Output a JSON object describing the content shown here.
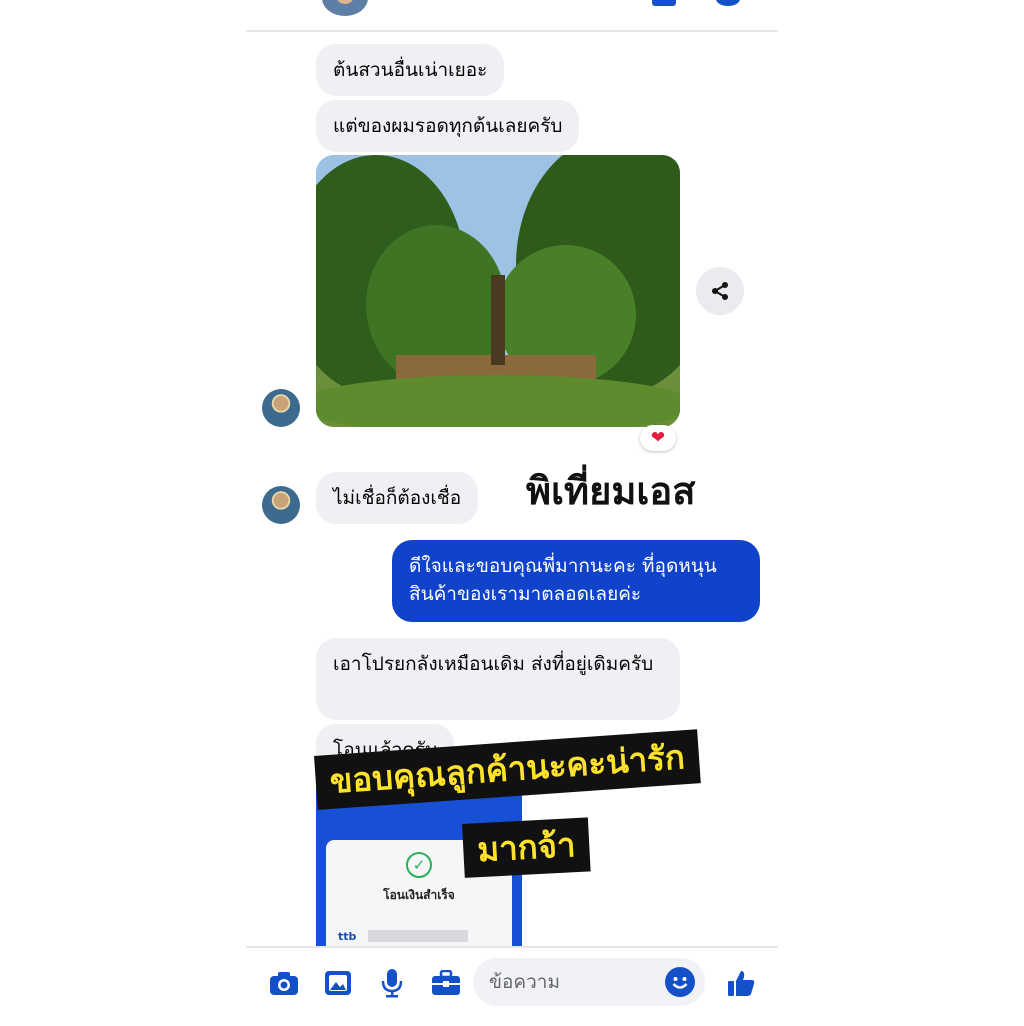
{
  "conversation": {
    "messages": [
      {
        "text": "ต้นสวนอื่นเน่าเยอะ"
      },
      {
        "text": "แต่ของผมรอดทุกต้นเลยครับ"
      },
      {
        "text": "ไม่เชื่อก็ต้องเชื่อ"
      },
      {
        "text": "ดีใจและขอบคุณพี่มากนะคะ ที่อุดหนุนสินค้าของเรามาตลอดเลยค่ะ"
      },
      {
        "text": "เอาโปรยกลังเหมือนเดิม ส่งที่อยู่เดิมครับ"
      },
      {
        "text": "โอนแล้วครับ"
      }
    ],
    "photo_reaction": "❤",
    "receipt": {
      "title": "โอนเงินสำเร็จ",
      "bank": "ttb"
    }
  },
  "overlay": {
    "watermark": "พิเที่ยมเอส",
    "caption_line1": "ขอบคุณลูกค้านะคะน่ารัก",
    "caption_line2": "มากจ้า"
  },
  "composer": {
    "placeholder": "ข้อความ"
  },
  "colors": {
    "accent": "#1451c9",
    "outgoing_bubble": "#1043c9",
    "incoming_bubble": "#eef0f3",
    "caption_text": "#ffe22c"
  }
}
